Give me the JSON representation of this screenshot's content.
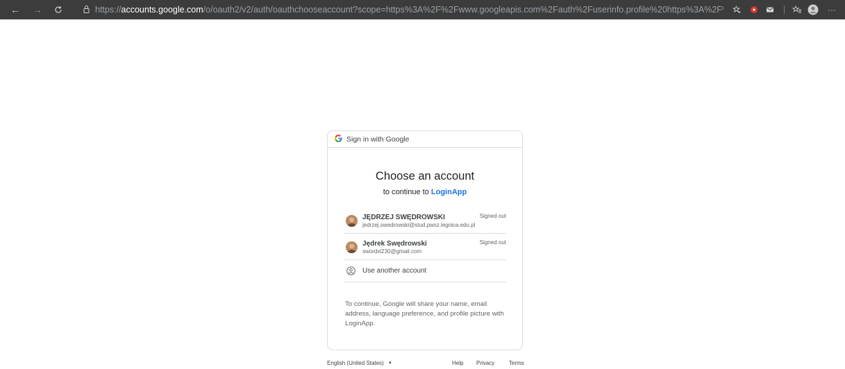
{
  "browser": {
    "url_scheme": "https://",
    "url_host": "accounts.google.com",
    "url_path": "/o/oauth2/v2/auth/oauthchooseaccount?scope=https%3A%2F%2Fwww.googleapis.com%2Fauth%2Fuserinfo.profile%20https%3A%2F%2Fwww.googleapis.com%2Fauth%2F...",
    "icons": [
      "back-arrow-icon",
      "forward-arrow-icon",
      "refresh-icon",
      "lock-icon",
      "favorite-add-icon",
      "extension-red-icon",
      "extension-mail-icon",
      "favorites-icon",
      "profile-icon",
      "more-icon"
    ]
  },
  "card": {
    "header_title": "Sign in with Google",
    "heading": "Choose an account",
    "subheading_prefix": "to continue to ",
    "app_name": "LoginApp",
    "accounts": [
      {
        "name": "JĘDRZEJ SWĘDROWSKI",
        "email": "jedrzej.swedrowski@stud.pwsz.legnica.edu.pl",
        "status": "Signed out"
      },
      {
        "name": "Jędrek Swędrowski",
        "email": "swordxl230@gmail.com",
        "status": "Signed out"
      }
    ],
    "use_another": "Use another account",
    "notice": "To continue, Google will share your name, email address, language preference, and profile picture with LoginApp."
  },
  "footer": {
    "language": "English (United States)",
    "help": "Help",
    "privacy": "Privacy",
    "terms": "Terms"
  },
  "colors": {
    "toolbar_bg": "#3c3c3c",
    "link_blue": "#1a73e8",
    "border": "#dadce0"
  }
}
